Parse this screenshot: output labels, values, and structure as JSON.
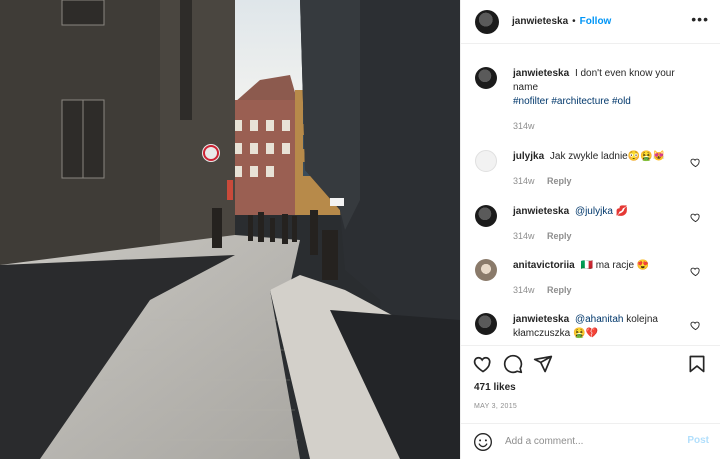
{
  "post": {
    "username": "janwieteska",
    "follow_label": "Follow",
    "separator": "•",
    "more_label": "•••",
    "photo_alt": "Narrow cobblestone street with old buildings"
  },
  "caption": {
    "username": "janwieteska",
    "text": "I don't even know your name",
    "hashtags": "#nofilter #architecture #old",
    "age": "314w"
  },
  "comments": [
    {
      "username": "julyjka",
      "text": "Jak zwykle ladnie",
      "emoji": "😳🤮😻",
      "age": "314w",
      "reply_label": "Reply"
    },
    {
      "username": "janwieteska",
      "mention": "@julyjka",
      "emoji": "💋",
      "age": "314w",
      "reply_label": "Reply"
    },
    {
      "username": "anitavictoriia",
      "emoji_pre": "🇮🇹",
      "text": "ma racje",
      "emoji": "😍",
      "age": "314w",
      "reply_label": "Reply"
    },
    {
      "username": "janwieteska",
      "mention": "@ahanitah",
      "text": "kolejna kłamczuszka",
      "emoji": "🤮💔"
    }
  ],
  "actions": {
    "likes": "471 likes",
    "date": "MAY 3, 2015"
  },
  "add_comment": {
    "placeholder": "Add a comment...",
    "post_label": "Post"
  },
  "colors": {
    "follow": "#0095f6",
    "hashtag": "#00376b",
    "muted": "#8e8e8e",
    "post_disabled": "#b2dffc"
  },
  "icons": [
    "heart-icon",
    "comment-icon",
    "share-icon",
    "bookmark-icon",
    "smiley-icon"
  ]
}
